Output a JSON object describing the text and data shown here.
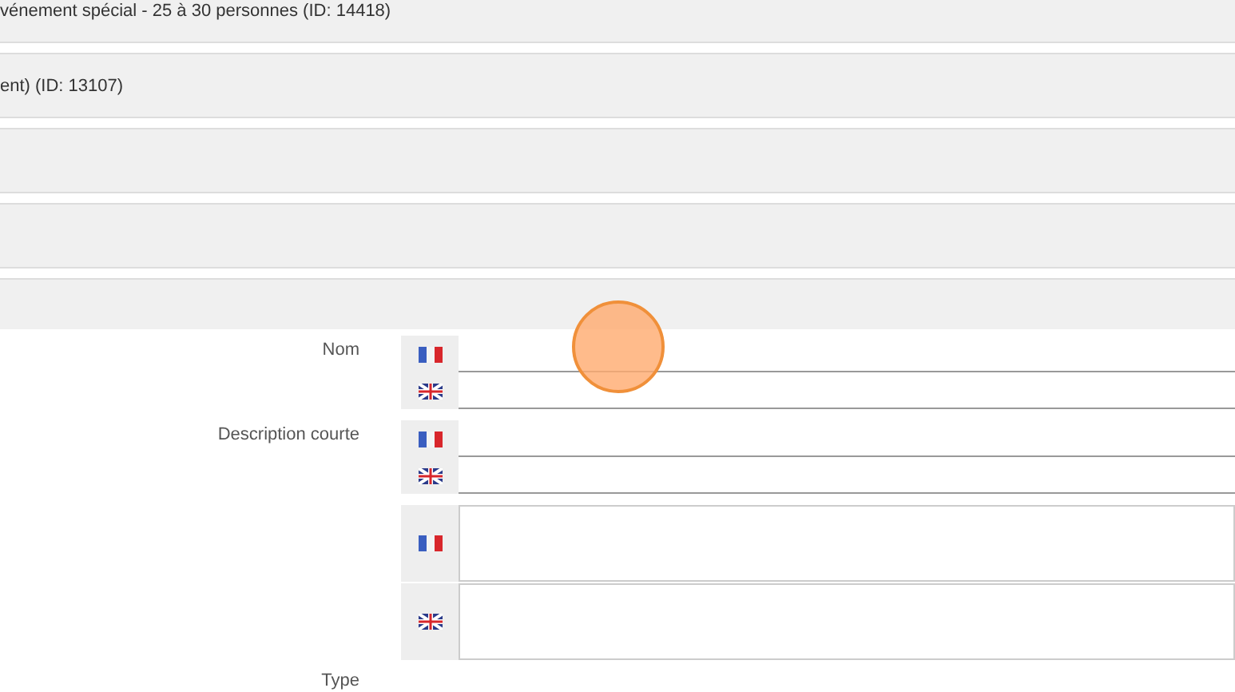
{
  "panels": [
    {
      "title": "vénement spécial - 25 à 30 personnes (ID: 14418)"
    },
    {
      "title": "ent) (ID: 13107)"
    }
  ],
  "fields": [
    {
      "label": "Nom",
      "kind": "line"
    },
    {
      "label": "Description courte",
      "kind": "line"
    },
    {
      "kind": "area"
    },
    {
      "label": "Type",
      "kind": "plain"
    }
  ]
}
